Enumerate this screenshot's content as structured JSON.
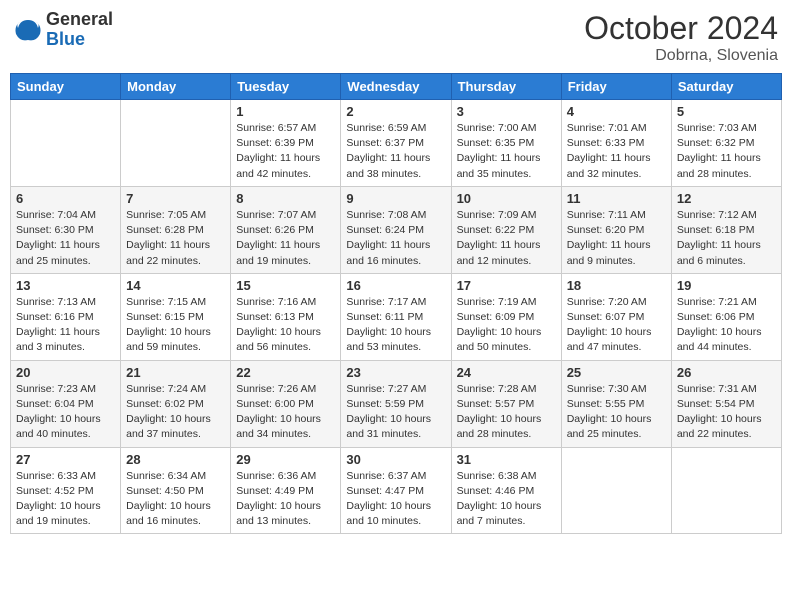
{
  "logo": {
    "general": "General",
    "blue": "Blue"
  },
  "header": {
    "month": "October 2024",
    "location": "Dobrna, Slovenia"
  },
  "weekdays": [
    "Sunday",
    "Monday",
    "Tuesday",
    "Wednesday",
    "Thursday",
    "Friday",
    "Saturday"
  ],
  "weeks": [
    [
      {
        "day": "",
        "sunrise": "",
        "sunset": "",
        "daylight": ""
      },
      {
        "day": "",
        "sunrise": "",
        "sunset": "",
        "daylight": ""
      },
      {
        "day": "1",
        "sunrise": "Sunrise: 6:57 AM",
        "sunset": "Sunset: 6:39 PM",
        "daylight": "Daylight: 11 hours and 42 minutes."
      },
      {
        "day": "2",
        "sunrise": "Sunrise: 6:59 AM",
        "sunset": "Sunset: 6:37 PM",
        "daylight": "Daylight: 11 hours and 38 minutes."
      },
      {
        "day": "3",
        "sunrise": "Sunrise: 7:00 AM",
        "sunset": "Sunset: 6:35 PM",
        "daylight": "Daylight: 11 hours and 35 minutes."
      },
      {
        "day": "4",
        "sunrise": "Sunrise: 7:01 AM",
        "sunset": "Sunset: 6:33 PM",
        "daylight": "Daylight: 11 hours and 32 minutes."
      },
      {
        "day": "5",
        "sunrise": "Sunrise: 7:03 AM",
        "sunset": "Sunset: 6:32 PM",
        "daylight": "Daylight: 11 hours and 28 minutes."
      }
    ],
    [
      {
        "day": "6",
        "sunrise": "Sunrise: 7:04 AM",
        "sunset": "Sunset: 6:30 PM",
        "daylight": "Daylight: 11 hours and 25 minutes."
      },
      {
        "day": "7",
        "sunrise": "Sunrise: 7:05 AM",
        "sunset": "Sunset: 6:28 PM",
        "daylight": "Daylight: 11 hours and 22 minutes."
      },
      {
        "day": "8",
        "sunrise": "Sunrise: 7:07 AM",
        "sunset": "Sunset: 6:26 PM",
        "daylight": "Daylight: 11 hours and 19 minutes."
      },
      {
        "day": "9",
        "sunrise": "Sunrise: 7:08 AM",
        "sunset": "Sunset: 6:24 PM",
        "daylight": "Daylight: 11 hours and 16 minutes."
      },
      {
        "day": "10",
        "sunrise": "Sunrise: 7:09 AM",
        "sunset": "Sunset: 6:22 PM",
        "daylight": "Daylight: 11 hours and 12 minutes."
      },
      {
        "day": "11",
        "sunrise": "Sunrise: 7:11 AM",
        "sunset": "Sunset: 6:20 PM",
        "daylight": "Daylight: 11 hours and 9 minutes."
      },
      {
        "day": "12",
        "sunrise": "Sunrise: 7:12 AM",
        "sunset": "Sunset: 6:18 PM",
        "daylight": "Daylight: 11 hours and 6 minutes."
      }
    ],
    [
      {
        "day": "13",
        "sunrise": "Sunrise: 7:13 AM",
        "sunset": "Sunset: 6:16 PM",
        "daylight": "Daylight: 11 hours and 3 minutes."
      },
      {
        "day": "14",
        "sunrise": "Sunrise: 7:15 AM",
        "sunset": "Sunset: 6:15 PM",
        "daylight": "Daylight: 10 hours and 59 minutes."
      },
      {
        "day": "15",
        "sunrise": "Sunrise: 7:16 AM",
        "sunset": "Sunset: 6:13 PM",
        "daylight": "Daylight: 10 hours and 56 minutes."
      },
      {
        "day": "16",
        "sunrise": "Sunrise: 7:17 AM",
        "sunset": "Sunset: 6:11 PM",
        "daylight": "Daylight: 10 hours and 53 minutes."
      },
      {
        "day": "17",
        "sunrise": "Sunrise: 7:19 AM",
        "sunset": "Sunset: 6:09 PM",
        "daylight": "Daylight: 10 hours and 50 minutes."
      },
      {
        "day": "18",
        "sunrise": "Sunrise: 7:20 AM",
        "sunset": "Sunset: 6:07 PM",
        "daylight": "Daylight: 10 hours and 47 minutes."
      },
      {
        "day": "19",
        "sunrise": "Sunrise: 7:21 AM",
        "sunset": "Sunset: 6:06 PM",
        "daylight": "Daylight: 10 hours and 44 minutes."
      }
    ],
    [
      {
        "day": "20",
        "sunrise": "Sunrise: 7:23 AM",
        "sunset": "Sunset: 6:04 PM",
        "daylight": "Daylight: 10 hours and 40 minutes."
      },
      {
        "day": "21",
        "sunrise": "Sunrise: 7:24 AM",
        "sunset": "Sunset: 6:02 PM",
        "daylight": "Daylight: 10 hours and 37 minutes."
      },
      {
        "day": "22",
        "sunrise": "Sunrise: 7:26 AM",
        "sunset": "Sunset: 6:00 PM",
        "daylight": "Daylight: 10 hours and 34 minutes."
      },
      {
        "day": "23",
        "sunrise": "Sunrise: 7:27 AM",
        "sunset": "Sunset: 5:59 PM",
        "daylight": "Daylight: 10 hours and 31 minutes."
      },
      {
        "day": "24",
        "sunrise": "Sunrise: 7:28 AM",
        "sunset": "Sunset: 5:57 PM",
        "daylight": "Daylight: 10 hours and 28 minutes."
      },
      {
        "day": "25",
        "sunrise": "Sunrise: 7:30 AM",
        "sunset": "Sunset: 5:55 PM",
        "daylight": "Daylight: 10 hours and 25 minutes."
      },
      {
        "day": "26",
        "sunrise": "Sunrise: 7:31 AM",
        "sunset": "Sunset: 5:54 PM",
        "daylight": "Daylight: 10 hours and 22 minutes."
      }
    ],
    [
      {
        "day": "27",
        "sunrise": "Sunrise: 6:33 AM",
        "sunset": "Sunset: 4:52 PM",
        "daylight": "Daylight: 10 hours and 19 minutes."
      },
      {
        "day": "28",
        "sunrise": "Sunrise: 6:34 AM",
        "sunset": "Sunset: 4:50 PM",
        "daylight": "Daylight: 10 hours and 16 minutes."
      },
      {
        "day": "29",
        "sunrise": "Sunrise: 6:36 AM",
        "sunset": "Sunset: 4:49 PM",
        "daylight": "Daylight: 10 hours and 13 minutes."
      },
      {
        "day": "30",
        "sunrise": "Sunrise: 6:37 AM",
        "sunset": "Sunset: 4:47 PM",
        "daylight": "Daylight: 10 hours and 10 minutes."
      },
      {
        "day": "31",
        "sunrise": "Sunrise: 6:38 AM",
        "sunset": "Sunset: 4:46 PM",
        "daylight": "Daylight: 10 hours and 7 minutes."
      },
      {
        "day": "",
        "sunrise": "",
        "sunset": "",
        "daylight": ""
      },
      {
        "day": "",
        "sunrise": "",
        "sunset": "",
        "daylight": ""
      }
    ]
  ]
}
